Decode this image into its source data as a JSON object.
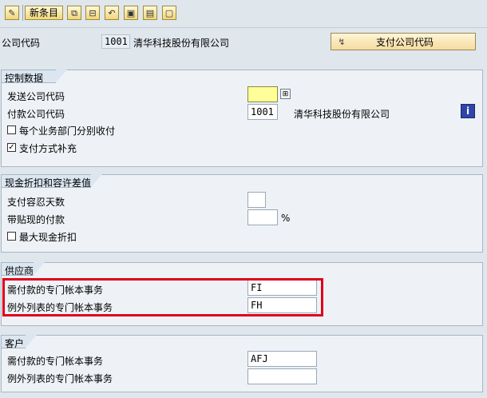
{
  "toolbar": {
    "items": [
      {
        "icon": "edit-icon",
        "glyph": "✎"
      },
      {
        "label": "新条目"
      },
      {
        "icon": "copy-icon",
        "glyph": "⧉"
      },
      {
        "icon": "delete-icon",
        "glyph": "⊟"
      },
      {
        "icon": "undo-icon",
        "glyph": "↶"
      },
      {
        "icon": "select-all-icon",
        "glyph": "▣"
      },
      {
        "icon": "select-block-icon",
        "glyph": "▤"
      },
      {
        "icon": "deselect-all-icon",
        "glyph": "▢"
      }
    ]
  },
  "company": {
    "label": "公司代码",
    "code": "1001",
    "name": "清华科技股份有限公司",
    "pay_button": "支付公司代码"
  },
  "control": {
    "title": "控制数据",
    "send_label": "发送公司代码",
    "send_value": "",
    "pay_label": "付款公司代码",
    "pay_value": "1001",
    "pay_name": "清华科技股份有限公司",
    "cb1_label": "每个业务部门分别收付",
    "cb1_checked": false,
    "cb2_label": "支付方式补充",
    "cb2_checked": true
  },
  "cash": {
    "title": "现金折扣和容许差值",
    "grace_label": "支付容忍天数",
    "grace_value": "",
    "discount_label": "带贴现的付款",
    "discount_value": "",
    "percent": "%",
    "cb_label": "最大现金折扣",
    "cb_checked": false
  },
  "vendor": {
    "title": "供应商",
    "sgl_label": "需付款的专门帐本事务",
    "sgl_value": "FI",
    "exc_label": "例外列表的专门帐本事务",
    "exc_value": "FH"
  },
  "customer": {
    "title": "客户",
    "sgl_label": "需付款的专门帐本事务",
    "sgl_value": "AFJ",
    "exc_label": "例外列表的专门帐本事务",
    "exc_value": ""
  }
}
